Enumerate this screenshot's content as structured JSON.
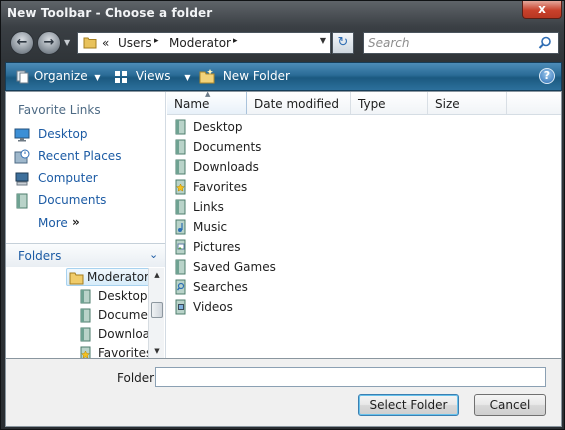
{
  "window": {
    "title": "New Toolbar - Choose a folder",
    "close_glyph": "x"
  },
  "address": {
    "overflow": "«",
    "crumbs": [
      "Users",
      "Moderator"
    ],
    "separator": "▸"
  },
  "search": {
    "placeholder": "Search"
  },
  "toolbar": {
    "organize_label": "Organize",
    "views_label": "Views",
    "new_folder_label": "New Folder",
    "help_glyph": "?"
  },
  "favorite_links": {
    "title": "Favorite Links",
    "items": [
      {
        "label": "Desktop",
        "icon": "desktop-icon"
      },
      {
        "label": "Recent Places",
        "icon": "recent-places-icon"
      },
      {
        "label": "Computer",
        "icon": "computer-icon"
      },
      {
        "label": "Documents",
        "icon": "documents-icon"
      }
    ],
    "more_label": "More",
    "more_arrows": "»"
  },
  "folders": {
    "title": "Folders",
    "tree": [
      {
        "label": "Moderator",
        "selected": true
      },
      {
        "label": "Desktop"
      },
      {
        "label": "Documents"
      },
      {
        "label": "Downloads"
      },
      {
        "label": "Favorites"
      }
    ]
  },
  "columns": [
    "Name",
    "Date modified",
    "Type",
    "Size"
  ],
  "files": [
    {
      "label": "Desktop",
      "icon": "folder-icon"
    },
    {
      "label": "Documents",
      "icon": "folder-icon"
    },
    {
      "label": "Downloads",
      "icon": "folder-icon"
    },
    {
      "label": "Favorites",
      "icon": "favorites-folder-icon"
    },
    {
      "label": "Links",
      "icon": "folder-icon"
    },
    {
      "label": "Music",
      "icon": "music-folder-icon"
    },
    {
      "label": "Pictures",
      "icon": "pictures-folder-icon"
    },
    {
      "label": "Saved Games",
      "icon": "folder-icon"
    },
    {
      "label": "Searches",
      "icon": "searches-folder-icon"
    },
    {
      "label": "Videos",
      "icon": "videos-folder-icon"
    }
  ],
  "footer": {
    "folder_label": "Folder:",
    "folder_value": "",
    "select_button": "Select Folder",
    "cancel_button": "Cancel"
  },
  "colors": {
    "command_bar": "#2a6b96",
    "link": "#1c5ba4",
    "close": "#c8412b"
  }
}
